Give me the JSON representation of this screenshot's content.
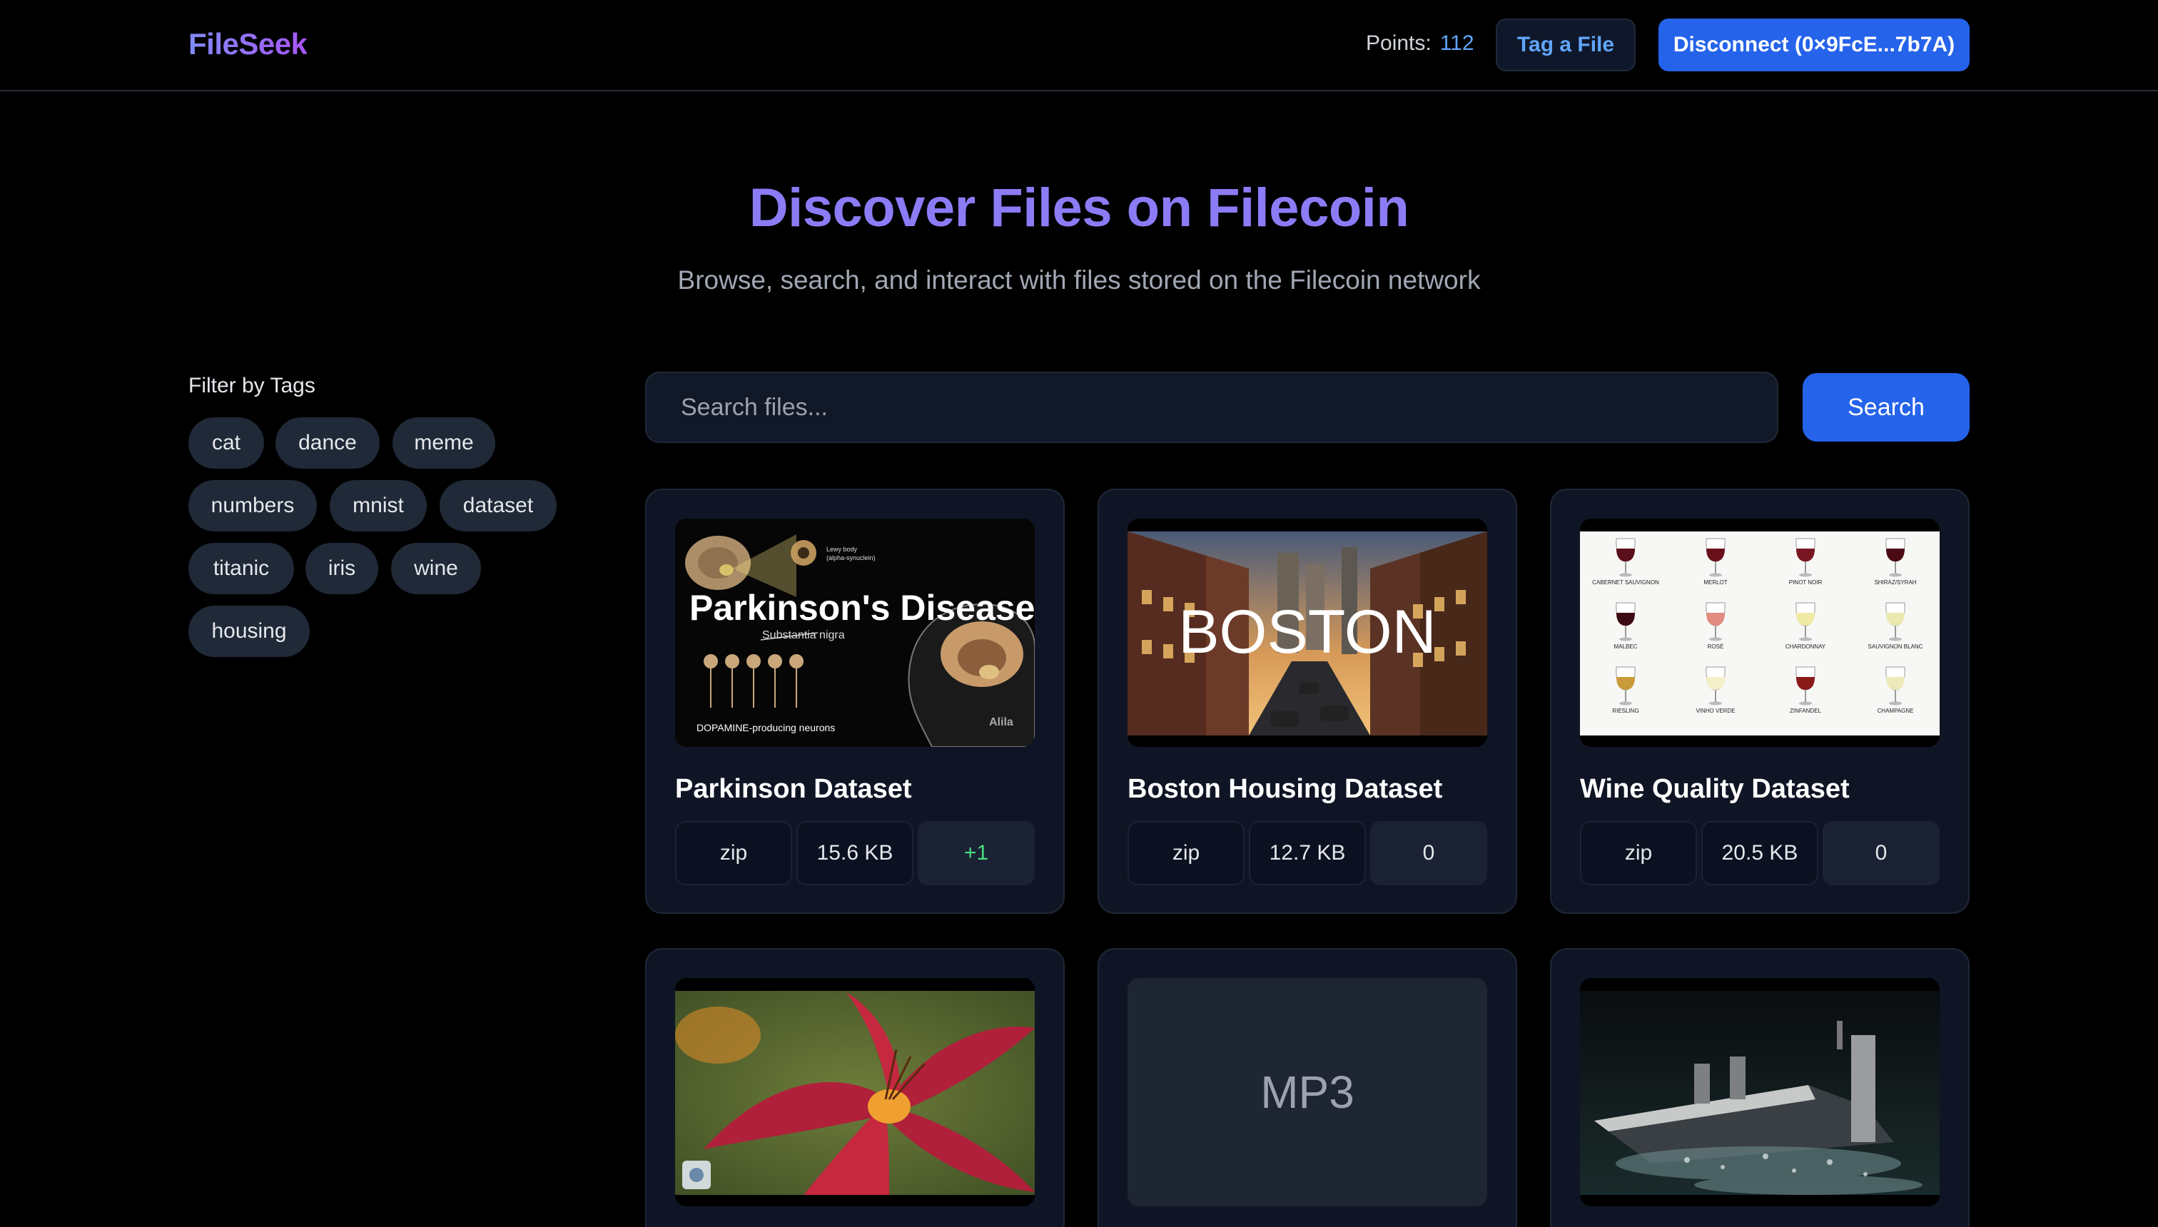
{
  "header": {
    "logo": "FileSeek",
    "points_label": "Points:",
    "points_value": "112",
    "tag_button": "Tag a File",
    "disconnect_button": "Disconnect (0×9FcE...7b7A)"
  },
  "hero": {
    "title": "Discover Files on Filecoin",
    "subtitle": "Browse, search, and interact with files stored on the Filecoin network"
  },
  "sidebar": {
    "title": "Filter by Tags",
    "tags": [
      "cat",
      "dance",
      "meme",
      "numbers",
      "mnist",
      "dataset",
      "titanic",
      "iris",
      "wine",
      "housing"
    ]
  },
  "search": {
    "placeholder": "Search files...",
    "button": "Search"
  },
  "cards": [
    {
      "title": "Parkinson Dataset",
      "type": "zip",
      "size": "15.6 KB",
      "score": "+1",
      "thumb_text": {
        "heading": "Parkinson's Disease",
        "sub": "Substantia nigra",
        "caption": "DOPAMINE-producing neurons",
        "lewy": "Lewy body",
        "lewy2": "(alpha-synuclein)",
        "brand": "Alila"
      }
    },
    {
      "title": "Boston Housing Dataset",
      "type": "zip",
      "size": "12.7 KB",
      "score": "0",
      "thumb_text": {
        "heading": "BOSTON"
      }
    },
    {
      "title": "Wine Quality Dataset",
      "type": "zip",
      "size": "20.5 KB",
      "score": "0",
      "thumb_text": {
        "wines": [
          "CABERNET SAUVIGNON",
          "MERLOT",
          "PINOT NOIR",
          "SHIRAZ/SYRAH",
          "MALBEC",
          "ROSÉ",
          "CHARDONNAY",
          "SAUVIGNON BLANC",
          "RIESLING",
          "VINHO VERDE",
          "ZINFANDEL",
          "CHAMPAGNE"
        ]
      }
    },
    {
      "title": "",
      "thumb_text": {}
    },
    {
      "title": "",
      "thumb_text": {
        "label": "MP3"
      }
    },
    {
      "title": "",
      "thumb_text": {}
    }
  ],
  "colors": {
    "accent": "#2563eb",
    "title_gradient_start": "#818cf8",
    "title_gradient_end": "#a855f7",
    "points": "#60a5fa",
    "positive_score": "#4ade80",
    "card_bg": "#0f1524"
  }
}
